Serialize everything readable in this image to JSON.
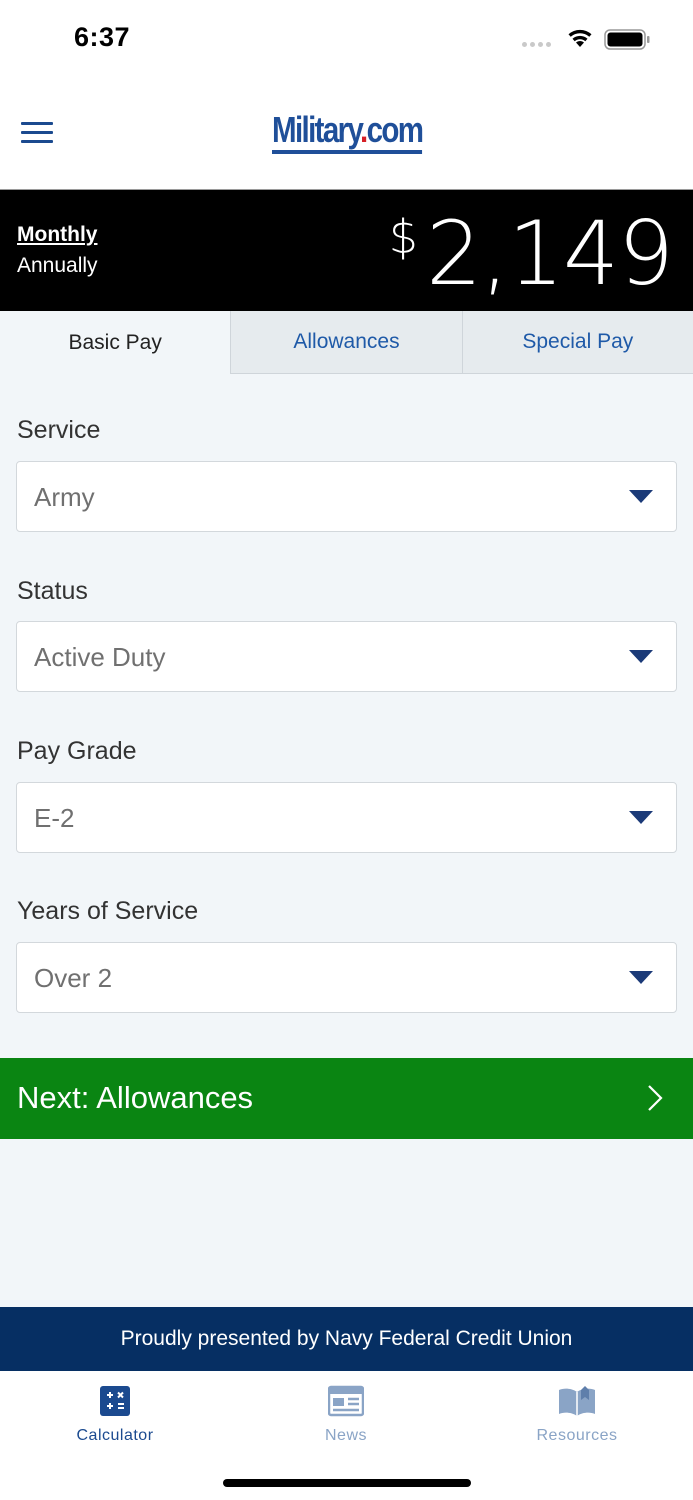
{
  "status_bar": {
    "time": "6:37"
  },
  "header": {
    "logo_text_main": "Military",
    "logo_text_dot": ".",
    "logo_text_tail": "com"
  },
  "pay": {
    "period_monthly": "Monthly",
    "period_annually": "Annually",
    "selected_period": "Monthly",
    "currency_symbol": "$",
    "amount": "2,149"
  },
  "tabs": [
    {
      "label": "Basic Pay",
      "active": true
    },
    {
      "label": "Allowances",
      "active": false
    },
    {
      "label": "Special Pay",
      "active": false
    }
  ],
  "form": {
    "service": {
      "label": "Service",
      "value": "Army"
    },
    "status": {
      "label": "Status",
      "value": "Active Duty"
    },
    "pay_grade": {
      "label": "Pay Grade",
      "value": "E-2"
    },
    "years_of_service": {
      "label": "Years of Service",
      "value": "Over 2"
    }
  },
  "next_button": {
    "label": "Next: Allowances"
  },
  "sponsor": {
    "text": "Proudly presented by Navy Federal Credit Union"
  },
  "bottom_nav": {
    "items": [
      {
        "label": "Calculator",
        "icon": "calculator-icon",
        "active": true
      },
      {
        "label": "News",
        "icon": "newspaper-icon",
        "active": false
      },
      {
        "label": "Resources",
        "icon": "book-icon",
        "active": false
      }
    ]
  },
  "colors": {
    "brand_blue": "#1f4f99",
    "accent_green": "#0a8512",
    "sponsor_navy": "#062f63",
    "nav_active": "#1b4a8f",
    "nav_inactive": "#8aa4c6"
  }
}
